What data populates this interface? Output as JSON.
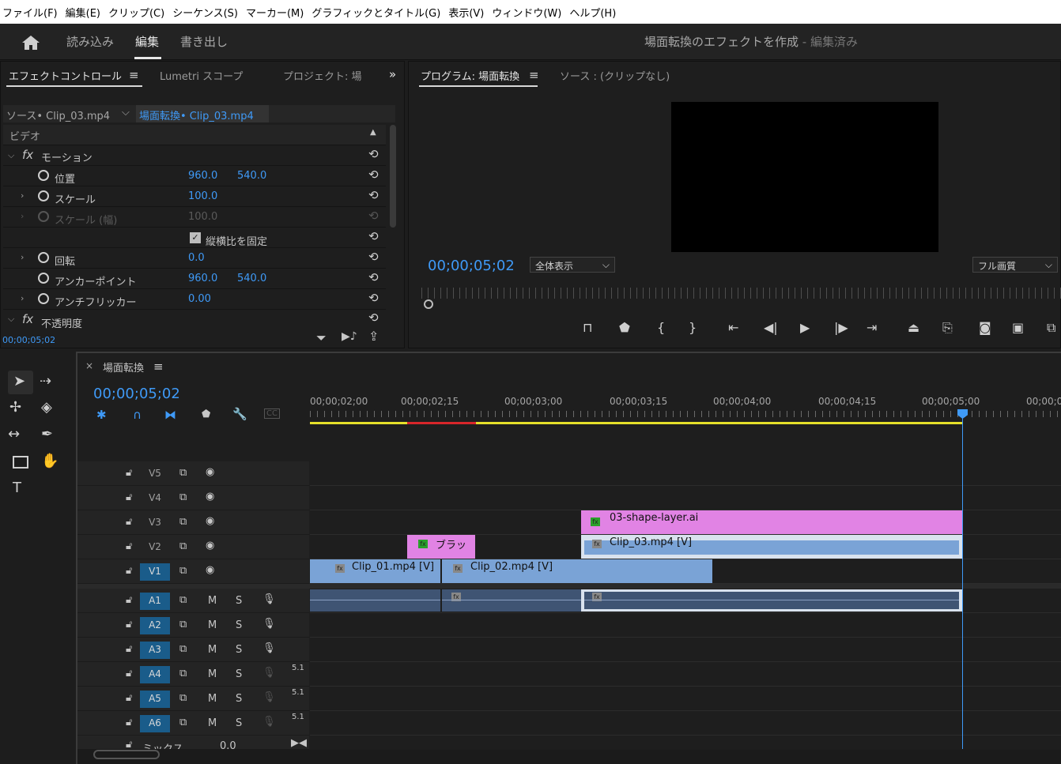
{
  "menu": [
    "ファイル(F)",
    "編集(E)",
    "クリップ(C)",
    "シーケンス(S)",
    "マーカー(M)",
    "グラフィックとタイトル(G)",
    "表示(V)",
    "ウィンドウ(W)",
    "ヘルプ(H)"
  ],
  "workspace": {
    "tabs": [
      "読み込み",
      "編集",
      "書き出し"
    ],
    "active": "編集",
    "doc_title": "場面転換のエフェクトを作成",
    "doc_status": "- 編集済み"
  },
  "effect_panel": {
    "tabs": [
      "エフェクトコントロール",
      "Lumetri スコープ",
      "プロジェクト: 場"
    ],
    "source_clip": "ソース• Clip_03.mp4",
    "seq_clip": "場面転換• Clip_03.mp4",
    "section": "ビデオ",
    "motion": "モーション",
    "position_label": "位置",
    "position_x": "960.0",
    "position_y": "540.0",
    "scale_label": "スケール",
    "scale_value": "100.0",
    "scale_width_label": "スケール (幅)",
    "scale_width_value": "100.0",
    "uniform_scale": "縦横比を固定",
    "rotation_label": "回転",
    "rotation_value": "0.0",
    "anchor_label": "アンカーポイント",
    "anchor_x": "960.0",
    "anchor_y": "540.0",
    "antiflicker_label": "アンチフリッカー",
    "antiflicker_value": "0.00",
    "opacity_label": "不透明度",
    "timecode": "00;00;05;02"
  },
  "program": {
    "tab": "プログラム: 場面転換",
    "source_tab": "ソース : (クリップなし)",
    "timecode": "00;00;05;02",
    "zoom": "全体表示",
    "quality": "フル画質"
  },
  "timeline": {
    "sequence": "場面転換",
    "timecode": "00;00;05;02",
    "ruler": [
      "00;00;02;00",
      "00;00;02;15",
      "00;00;03;00",
      "00;00;03;15",
      "00;00;04;00",
      "00;00;04;15",
      "00;00;05;00",
      "00;00;05;"
    ],
    "video_tracks": [
      "V5",
      "V4",
      "V3",
      "V2",
      "V1"
    ],
    "audio_tracks": [
      "A1",
      "A2",
      "A3",
      "A4",
      "A5",
      "A6"
    ],
    "channel_label": "5.1",
    "mix_label": "ミックス",
    "mix_value": "0.0",
    "clips": {
      "shape": "03-shape-layer.ai",
      "blur": "ブラッ",
      "clip3": "Clip_03.mp4 [V]",
      "clip1": "Clip_01.mp4 [V]",
      "clip2": "Clip_02.mp4 [V]"
    }
  },
  "colors": {
    "accent": "#3f9af7",
    "shape_clip": "#e183e4",
    "video_clip": "#7aa3d6",
    "audio_clip": "#3f5473",
    "track_target": "#1a5c8a"
  },
  "icons": [
    "home-icon",
    "menu-icon",
    "stopwatch-icon",
    "reset-icon",
    "selection-tool-icon",
    "hand-tool-icon",
    "type-tool-icon",
    "play-icon",
    "camera-icon",
    "lock-icon",
    "eye-icon",
    "mic-icon"
  ]
}
